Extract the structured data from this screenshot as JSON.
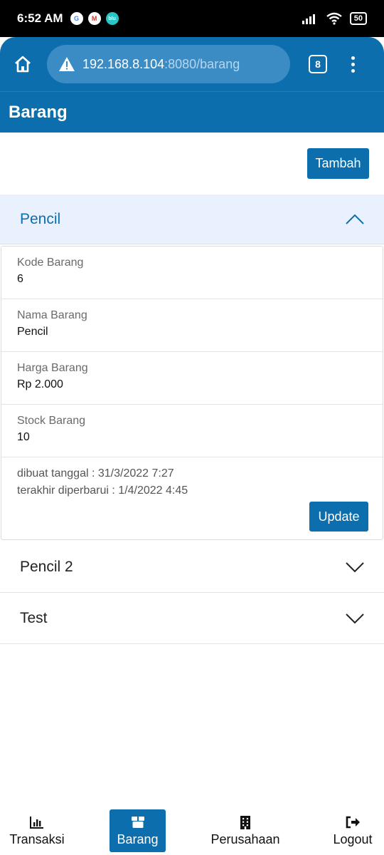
{
  "status_bar": {
    "time": "6:52 AM",
    "battery": "50",
    "app_icons": [
      "google-icon",
      "gmail-icon",
      "blu-icon"
    ]
  },
  "browser": {
    "url_host": "192.168.8.104",
    "url_path": ":8080/barang",
    "tab_count": "8"
  },
  "header": {
    "title": "Barang"
  },
  "actions": {
    "add_label": "Tambah"
  },
  "accordion": {
    "open_item": {
      "title": "Pencil",
      "fields": [
        {
          "label": "Kode Barang",
          "value": "6"
        },
        {
          "label": "Nama Barang",
          "value": "Pencil"
        },
        {
          "label": "Harga Barang",
          "value": "Rp 2.000"
        },
        {
          "label": "Stock Barang",
          "value": "10"
        }
      ],
      "created": "dibuat tanggal : 31/3/2022 7:27",
      "updated": "terakhir diperbarui : 1/4/2022 4:45",
      "update_label": "Update"
    },
    "closed_items": [
      {
        "title": "Pencil 2"
      },
      {
        "title": "Test"
      }
    ]
  },
  "bottom_nav": {
    "items": [
      {
        "label": "Transaksi",
        "icon": "bar-chart-icon",
        "active": false
      },
      {
        "label": "Barang",
        "icon": "box-icon",
        "active": true
      },
      {
        "label": "Perusahaan",
        "icon": "building-icon",
        "active": false
      },
      {
        "label": "Logout",
        "icon": "logout-icon",
        "active": false
      }
    ]
  },
  "colors": {
    "primary": "#0d6eae",
    "accordion_active_bg": "#e8f1fd"
  }
}
